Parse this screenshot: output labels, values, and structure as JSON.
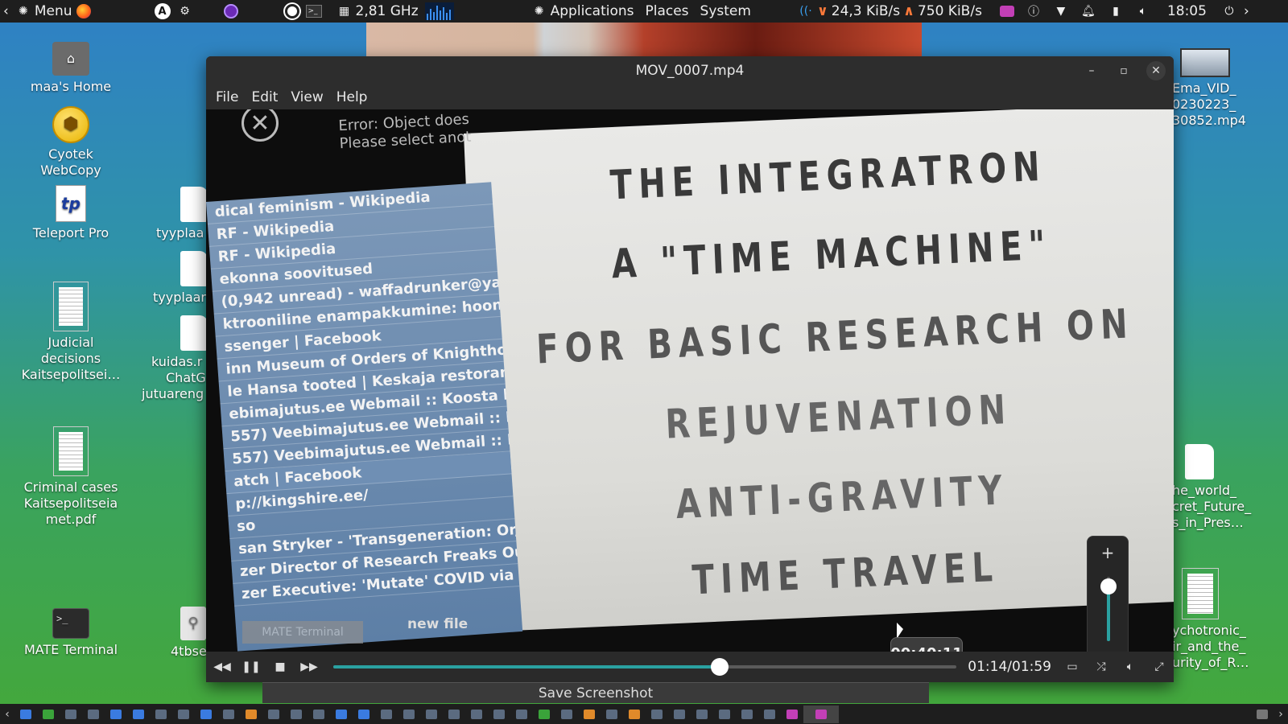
{
  "top_panel": {
    "menu_label": "Menu",
    "cpu_freq": "2,81 GHz",
    "applications_label": "Applications",
    "places_label": "Places",
    "system_label": "System",
    "net_down": "24,3 KiB/s",
    "net_up": "750 KiB/s",
    "clock": "18:05"
  },
  "desktop_icons": {
    "home": "maa's Home",
    "cyotek_line1": "Cyotek",
    "cyotek_line2": "WebCopy",
    "teleport": "Teleport Pro",
    "tyyplaa1": "tyyplaa",
    "tyyplaa2": "tyyplaar",
    "kuidas_line1": "kuidas.r",
    "kuidas_line2": "ChatG",
    "kuidas_line3": "jutuareng",
    "judicial_line1": "Judicial",
    "judicial_line2": "decisions",
    "judicial_line3": "Kaitsepolitsei…",
    "criminal_line1": "Criminal cases",
    "criminal_line2": "Kaitsepolitseia",
    "criminal_line3": "met.pdf",
    "terminal": "MATE Terminal",
    "usb": "4tbse",
    "ema_line1": "Ema_VID_",
    "ema_line2": "0230223_",
    "ema_line3": "30852.mp4",
    "world_line1": "he_world_",
    "world_line2": "cret_Future_",
    "world_line3": "s_in_Pres…",
    "psycho_line1": "ychotronic_",
    "psycho_line2": "ir_and_the_",
    "psycho_line3": "urity_of_R…"
  },
  "window": {
    "title": "MOV_0007.mp4",
    "menu": [
      "File",
      "Edit",
      "View",
      "Help"
    ]
  },
  "video": {
    "error_line1": "Error: Object does",
    "error_line2": "Please select anot",
    "sign_lines": [
      "THE INTEGRATRON",
      "A \"TIME MACHINE\"",
      "FOR BASIC RESEARCH ON",
      "REJUVENATION",
      "ANTI-GRAVITY",
      "TIME TRAVEL"
    ],
    "browser_rows": [
      "dical feminism - Wikipedia",
      "RF - Wikipedia",
      "RF - Wikipedia",
      "ekonna soovitused",
      "(0,942 unread) - waffadrunker@yah",
      "ktrooniline enampakkumine: hoone",
      "ssenger | Facebook",
      "inn Museum of Orders of Knighthoo",
      "le Hansa tooted | Keskaja restoran j",
      "ebimajutus.ee Webmail :: Koosta kir",
      "557) Veebimajutus.ee Webmail :: II",
      "557) Veebimajutus.ee Webmail :: II",
      "atch | Facebook",
      "p://kingshire.ee/",
      "so",
      "san Stryker - 'Transgeneration: Or, E",
      "zer Director of Research Freaks Out",
      "zer Executive: 'Mutate' COVID via 'E"
    ],
    "mate_terminal": "MATE Terminal",
    "new_file": "new file",
    "hover_time": "00:40:11"
  },
  "player": {
    "time_label": "01:14/01:59",
    "progress": 0.62,
    "volume": 0.85,
    "save_screenshot": "Save Screenshot",
    "accent": "#2aa1a1"
  }
}
